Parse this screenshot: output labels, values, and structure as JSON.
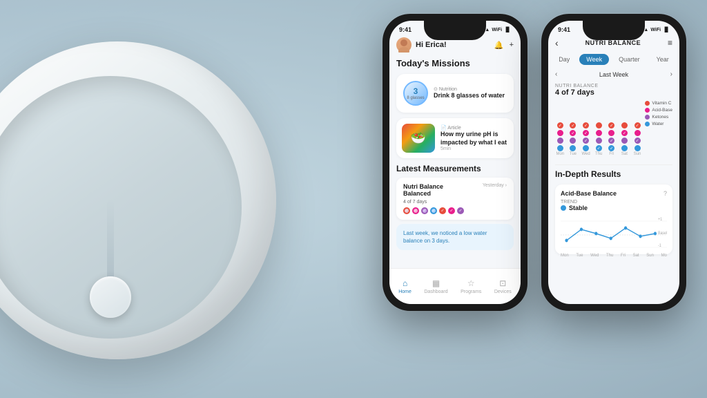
{
  "background": {
    "color_from": "#b8cdd8",
    "color_to": "#9bb0bc"
  },
  "phone1": {
    "status_bar": {
      "time": "9:41",
      "signal": "●●●",
      "wifi": "WiFi",
      "battery": "▐"
    },
    "header": {
      "greeting": "Hi Erica!",
      "notification_icon": "🔔",
      "add_icon": "+"
    },
    "missions_section": {
      "title": "Today's Missions",
      "water_mission": {
        "count": "3",
        "unit": "8 glasses",
        "tag": "Nutrition",
        "description": "Drink 8 glasses of water"
      },
      "article_mission": {
        "tag": "Article",
        "title": "How my urine pH is impacted by what I eat",
        "time": "5min"
      }
    },
    "measurements_section": {
      "title": "Latest Measurements",
      "card": {
        "title": "Nutri Balance Balanced",
        "date": "Yesterday",
        "subtitle": "4 of 7 days",
        "dots": [
          {
            "color": "#e74c3c",
            "checked": true
          },
          {
            "color": "#e91e8c",
            "checked": true
          },
          {
            "color": "#9b59b6",
            "checked": true
          },
          {
            "color": "#3498db",
            "checked": true
          },
          {
            "color": "#27ae60",
            "checked": true
          },
          {
            "color": "#1abc9c",
            "checked": true
          },
          {
            "color": "#f39c12",
            "checked": false
          }
        ]
      },
      "alert": "Last week, we noticed a low water balance on 3 days."
    },
    "bottom_nav": {
      "items": [
        {
          "label": "Home",
          "icon": "⊞",
          "active": true
        },
        {
          "label": "Dashboard",
          "icon": "▦",
          "active": false
        },
        {
          "label": "Programs",
          "icon": "☆",
          "active": false
        },
        {
          "label": "Devices",
          "icon": "⊡",
          "active": false
        }
      ]
    }
  },
  "phone2": {
    "status_bar": {
      "time": "9:41",
      "signal": "●●●",
      "wifi": "WiFi",
      "battery": "▐"
    },
    "header": {
      "back_icon": "‹",
      "title": "NUTRI BALANCE",
      "menu_icon": "≡"
    },
    "period_tabs": [
      "Day",
      "Week",
      "Quarter",
      "Year"
    ],
    "active_tab": "Week",
    "week_nav": {
      "prev": "‹",
      "label": "Last Week",
      "next": "›"
    },
    "chart_section": {
      "label": "NUTRI BALANCE",
      "subtitle": "4 of 7 days",
      "days": [
        "Mon",
        "Tue",
        "Wed",
        "Thu",
        "Fri",
        "Sat",
        "Sun"
      ],
      "dot_colors": [
        "#e74c3c",
        "#e91e8c",
        "#9b59b6",
        "#8e44ad",
        "#7f8c8d",
        "#3498db",
        "#1abc9c"
      ],
      "legend": [
        {
          "label": "Vitamin C",
          "color": "#e74c3c"
        },
        {
          "label": "Acid-Base",
          "color": "#e91e8c"
        },
        {
          "label": "Ketones",
          "color": "#9b59b6"
        },
        {
          "label": "Water",
          "color": "#3498db"
        }
      ]
    },
    "in_depth": {
      "title": "In-Depth Results",
      "result": {
        "name": "Acid-Base Balance",
        "info_icon": "?",
        "trend_label": "TREND",
        "trend_value": "Stable",
        "chart_labels": {
          "+1": "+1",
          "baseline": "Baseline",
          "-1": "-1"
        },
        "days": [
          "Mon",
          "Tue",
          "Wed",
          "Thu",
          "Fri",
          "Sat",
          "Sun",
          "Mo"
        ]
      }
    }
  }
}
